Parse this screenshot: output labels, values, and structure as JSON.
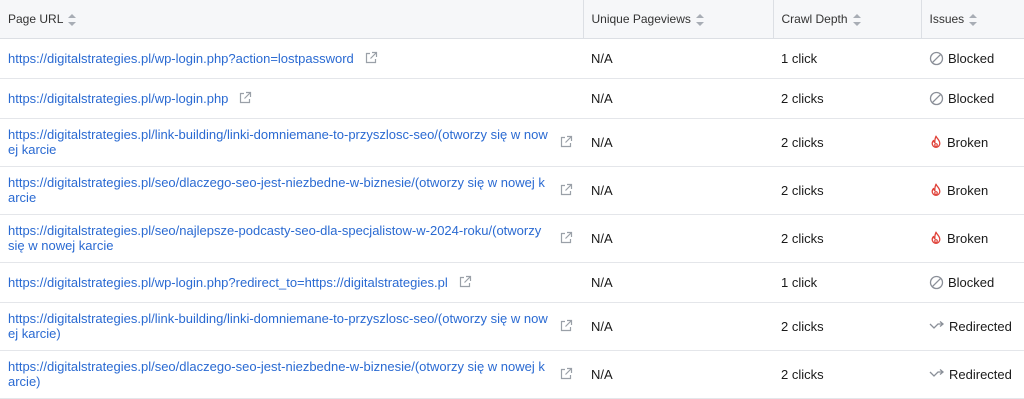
{
  "columns": {
    "url": "Page URL",
    "pageviews": "Unique Pageviews",
    "depth": "Crawl Depth",
    "issues": "Issues"
  },
  "rows": [
    {
      "url": "https://digitalstrategies.pl/wp-login.php?action=lostpassword",
      "pageviews": "N/A",
      "depth": "1 click",
      "issue": "Blocked",
      "issue_icon": "blocked-icon"
    },
    {
      "url": "https://digitalstrategies.pl/wp-login.php",
      "pageviews": "N/A",
      "depth": "2 clicks",
      "issue": "Blocked",
      "issue_icon": "blocked-icon"
    },
    {
      "url": "https://digitalstrategies.pl/link-building/linki-domniemane-to-przyszlosc-seo/(otworzy się w nowej karcie",
      "pageviews": "N/A",
      "depth": "2 clicks",
      "issue": "Broken",
      "issue_icon": "broken-flame-icon"
    },
    {
      "url": "https://digitalstrategies.pl/seo/dlaczego-seo-jest-niezbedne-w-biznesie/(otworzy się w nowej karcie",
      "pageviews": "N/A",
      "depth": "2 clicks",
      "issue": "Broken",
      "issue_icon": "broken-flame-icon"
    },
    {
      "url": "https://digitalstrategies.pl/seo/najlepsze-podcasty-seo-dla-specjalistow-w-2024-roku/(otworzy się w nowej karcie",
      "pageviews": "N/A",
      "depth": "2 clicks",
      "issue": "Broken",
      "issue_icon": "broken-flame-icon"
    },
    {
      "url": "https://digitalstrategies.pl/wp-login.php?redirect_to=https://digitalstrategies.pl",
      "pageviews": "N/A",
      "depth": "1 click",
      "issue": "Blocked",
      "issue_icon": "blocked-icon"
    },
    {
      "url": "https://digitalstrategies.pl/link-building/linki-domniemane-to-przyszlosc-seo/(otworzy się w nowej karcie)",
      "pageviews": "N/A",
      "depth": "2 clicks",
      "issue": "Redirected",
      "issue_icon": "redirect-arrow-icon"
    },
    {
      "url": "https://digitalstrategies.pl/seo/dlaczego-seo-jest-niezbedne-w-biznesie/(otworzy się w nowej karcie)",
      "pageviews": "N/A",
      "depth": "2 clicks",
      "issue": "Redirected",
      "issue_icon": "redirect-arrow-icon"
    }
  ],
  "colors": {
    "link": "#2a6ad2",
    "broken": "#e0433a",
    "muted_icon": "#8a8f98",
    "header_bg": "#f6f7f9"
  }
}
